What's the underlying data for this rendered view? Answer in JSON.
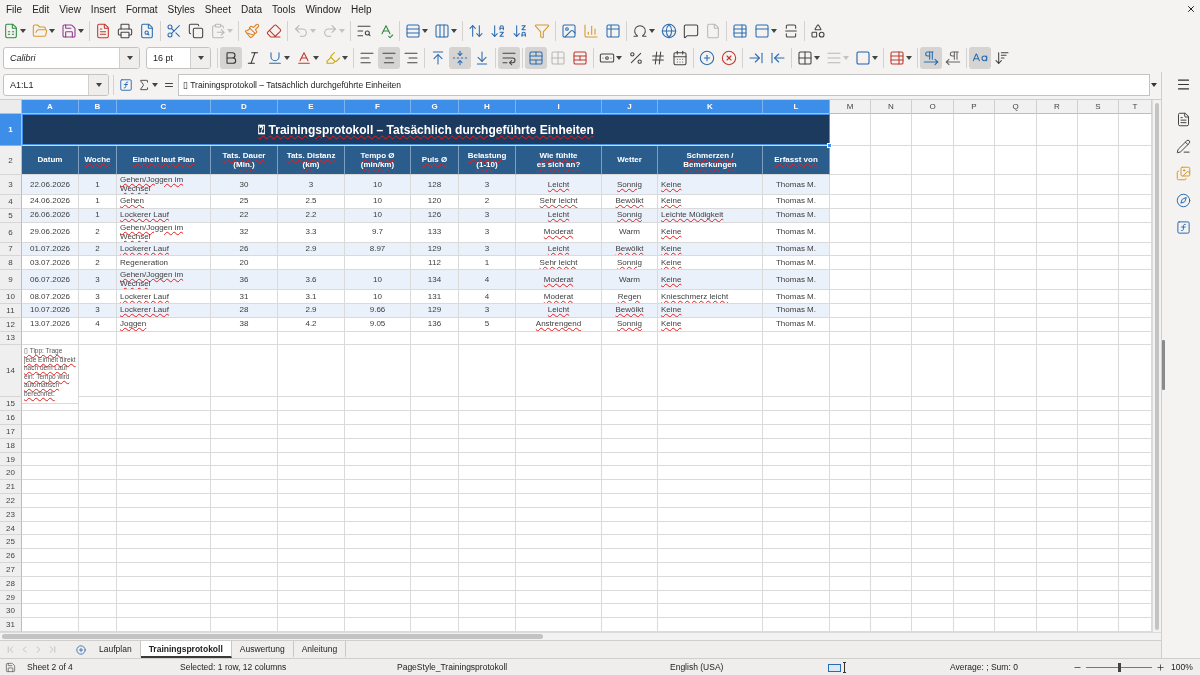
{
  "menu_bar": {
    "items": [
      "File",
      "Edit",
      "View",
      "Insert",
      "Format",
      "Styles",
      "Sheet",
      "Data",
      "Tools",
      "Window",
      "Help"
    ]
  },
  "standard_toolbar": {
    "buttons": [
      {
        "disabled": false
      },
      {
        "disabled": false
      },
      {
        "disabled": false
      },
      {
        "disabled": false
      },
      {
        "disabled": false
      },
      {
        "disabled": false
      },
      {
        "disabled": false
      },
      {
        "disabled": false
      },
      {
        "disabled": true
      },
      {
        "disabled": false
      },
      {
        "disabled": false
      },
      {
        "disabled": true
      },
      {
        "disabled": true
      },
      {
        "disabled": false
      },
      {
        "disabled": false
      },
      {
        "disabled": false
      },
      {
        "disabled": false
      },
      {
        "disabled": false
      },
      {
        "disabled": false
      },
      {
        "disabled": false
      },
      {
        "disabled": false
      },
      {
        "disabled": false
      },
      {
        "disabled": false
      },
      {
        "disabled": false
      },
      {
        "disabled": false
      },
      {
        "disabled": false
      },
      {
        "disabled": false
      },
      {
        "disabled": true
      },
      {
        "disabled": false
      },
      {
        "disabled": false
      },
      {
        "disabled": false
      },
      {
        "disabled": false
      }
    ]
  },
  "formatting_toolbar": {
    "font_name": "Calibri",
    "font_size": "16 pt",
    "buttons": [
      {
        "pressed": true,
        "disabled": false
      },
      {
        "pressed": false,
        "disabled": false
      },
      {
        "pressed": false,
        "disabled": false
      },
      {
        "pressed": false,
        "disabled": false
      },
      {
        "pressed": false,
        "disabled": false
      },
      {
        "pressed": false,
        "disabled": false
      },
      {
        "pressed": true,
        "disabled": false
      },
      {
        "pressed": false,
        "disabled": false
      },
      {
        "pressed": false,
        "disabled": false
      },
      {
        "pressed": true,
        "disabled": false
      },
      {
        "pressed": false,
        "disabled": false
      },
      {
        "pressed": true,
        "disabled": false
      },
      {
        "pressed": true,
        "disabled": false
      },
      {
        "pressed": false,
        "disabled": true
      },
      {
        "pressed": false,
        "disabled": false
      },
      {
        "pressed": false,
        "disabled": false
      },
      {
        "pressed": false,
        "disabled": false
      },
      {
        "pressed": false,
        "disabled": false
      },
      {
        "pressed": false,
        "disabled": false
      },
      {
        "pressed": false,
        "disabled": false
      },
      {
        "pressed": false,
        "disabled": false
      },
      {
        "pressed": false,
        "disabled": false
      },
      {
        "pressed": false,
        "disabled": false
      },
      {
        "pressed": false,
        "disabled": false
      },
      {
        "pressed": false,
        "disabled": true
      },
      {
        "pressed": false,
        "disabled": false
      },
      {
        "pressed": false,
        "disabled": false
      },
      {
        "pressed": true,
        "disabled": false
      },
      {
        "pressed": false,
        "disabled": false
      },
      {
        "pressed": true,
        "disabled": false
      },
      {
        "pressed": false,
        "disabled": false
      }
    ]
  },
  "formula_bar": {
    "name_box": "A1:L1",
    "content": "▯ Trainingsprotokoll – Tatsächlich durchgeführte Einheiten"
  },
  "sheet": {
    "columns": [
      {
        "letter": "A",
        "selected": true
      },
      {
        "letter": "B",
        "selected": true
      },
      {
        "letter": "C",
        "selected": true
      },
      {
        "letter": "D",
        "selected": true
      },
      {
        "letter": "E",
        "selected": true
      },
      {
        "letter": "F",
        "selected": true
      },
      {
        "letter": "G",
        "selected": true
      },
      {
        "letter": "H",
        "selected": true
      },
      {
        "letter": "I",
        "selected": true
      },
      {
        "letter": "J",
        "selected": true
      },
      {
        "letter": "K",
        "selected": true
      },
      {
        "letter": "L",
        "selected": true
      },
      {
        "letter": "M",
        "selected": false
      },
      {
        "letter": "N",
        "selected": false
      },
      {
        "letter": "O",
        "selected": false
      },
      {
        "letter": "P",
        "selected": false
      },
      {
        "letter": "Q",
        "selected": false
      },
      {
        "letter": "R",
        "selected": false
      },
      {
        "letter": "S",
        "selected": false
      },
      {
        "letter": "T",
        "selected": false
      }
    ],
    "row_headers": [
      {
        "label": "1",
        "selected": true
      },
      {
        "label": "2",
        "selected": false
      },
      {
        "label": "3",
        "selected": false
      },
      {
        "label": "4",
        "selected": false
      },
      {
        "label": "5",
        "selected": false
      },
      {
        "label": "6",
        "selected": false
      },
      {
        "label": "7",
        "selected": false
      },
      {
        "label": "8",
        "selected": false
      },
      {
        "label": "9",
        "selected": false
      },
      {
        "label": "10",
        "selected": false
      },
      {
        "label": "11",
        "selected": false
      },
      {
        "label": "12",
        "selected": false
      },
      {
        "label": "13",
        "selected": false
      },
      {
        "label": "14",
        "selected": false
      },
      {
        "label": "15",
        "selected": false
      },
      {
        "label": "16",
        "selected": false
      },
      {
        "label": "17",
        "selected": false
      },
      {
        "label": "18",
        "selected": false
      },
      {
        "label": "19",
        "selected": false
      },
      {
        "label": "20",
        "selected": false
      },
      {
        "label": "21",
        "selected": false
      },
      {
        "label": "22",
        "selected": false
      },
      {
        "label": "23",
        "selected": false
      },
      {
        "label": "24",
        "selected": false
      },
      {
        "label": "25",
        "selected": false
      },
      {
        "label": "26",
        "selected": false
      },
      {
        "label": "27",
        "selected": false
      },
      {
        "label": "28",
        "selected": false
      },
      {
        "label": "29",
        "selected": false
      },
      {
        "label": "30",
        "selected": false
      },
      {
        "label": "31",
        "selected": false
      }
    ],
    "title": {
      "text": "⍰ Trainingsprotokoll – Tatsächlich durchgeführte Einheiten",
      "spell_marked": true,
      "selected": true
    },
    "header": [
      {
        "text": "Datum",
        "spell_marked": false
      },
      {
        "text": "Woche",
        "spell_marked": true
      },
      {
        "text": "Einheit laut Plan",
        "spell_marked": true
      },
      {
        "text": "Tats. Dauer\n(Min.)",
        "spell_marked": true
      },
      {
        "text": "Tats. Distanz\n(km)",
        "spell_marked": true
      },
      {
        "text": "Tempo Ø\n(min/km)",
        "spell_marked": true
      },
      {
        "text": "Puls Ø",
        "spell_marked": true
      },
      {
        "text": "Belastung\n(1-10)",
        "spell_marked": true
      },
      {
        "text": "Wie fühlte\nes sich an?",
        "spell_marked": true
      },
      {
        "text": "Wetter",
        "spell_marked": false
      },
      {
        "text": "Schmerzen /\nBemerkungen",
        "spell_marked": true
      },
      {
        "text": "Erfasst von",
        "spell_marked": true
      }
    ],
    "rows": [
      {
        "date": "22.06.2026",
        "week": "1",
        "session": "Gehen/Joggen im Wechsel",
        "duration": "30",
        "distance": "3",
        "pace": "10",
        "pulse": "128",
        "load": "3",
        "feeling": "Leicht",
        "weather": "Sonnig",
        "remarks": "Keine",
        "recorded_by": "Thomas M.",
        "session_marked": true,
        "feeling_marked": true,
        "weather_marked": true,
        "remarks_marked": true
      },
      {
        "date": "24.06.2026",
        "week": "1",
        "session": "Gehen",
        "duration": "25",
        "distance": "2.5",
        "pace": "10",
        "pulse": "120",
        "load": "2",
        "feeling": "Sehr leicht",
        "weather": "Bewölkt",
        "remarks": "Keine",
        "recorded_by": "Thomas M.",
        "session_marked": true,
        "feeling_marked": true,
        "weather_marked": true,
        "remarks_marked": true
      },
      {
        "date": "26.06.2026",
        "week": "1",
        "session": "Lockerer Lauf",
        "duration": "22",
        "distance": "2.2",
        "pace": "10",
        "pulse": "126",
        "load": "3",
        "feeling": "Leicht",
        "weather": "Sonnig",
        "remarks": "Leichte Müdigkeit",
        "recorded_by": "Thomas M.",
        "session_marked": true,
        "feeling_marked": true,
        "weather_marked": true,
        "remarks_marked": true
      },
      {
        "date": "29.06.2026",
        "week": "2",
        "session": "Gehen/Joggen im Wechsel",
        "duration": "32",
        "distance": "3.3",
        "pace": "9.7",
        "pulse": "133",
        "load": "3",
        "feeling": "Moderat",
        "weather": "Warm",
        "remarks": "Keine",
        "recorded_by": "Thomas M.",
        "session_marked": true,
        "feeling_marked": true,
        "weather_marked": false,
        "remarks_marked": true
      },
      {
        "date": "01.07.2026",
        "week": "2",
        "session": "Lockerer Lauf",
        "duration": "26",
        "distance": "2.9",
        "pace": "8.97",
        "pulse": "129",
        "load": "3",
        "feeling": "Leicht",
        "weather": "Bewölkt",
        "remarks": "Keine",
        "recorded_by": "Thomas M.",
        "session_marked": true,
        "feeling_marked": true,
        "weather_marked": true,
        "remarks_marked": true
      },
      {
        "date": "03.07.2026",
        "week": "2",
        "session": "Regeneration",
        "duration": "20",
        "pulse": "112",
        "load": "1",
        "feeling": "Sehr leicht",
        "weather": "Sonnig",
        "remarks": "Keine",
        "recorded_by": "Thomas M.",
        "session_marked": false,
        "feeling_marked": true,
        "weather_marked": true,
        "remarks_marked": true
      },
      {
        "date": "06.07.2026",
        "week": "3",
        "session": "Gehen/Joggen im Wechsel",
        "duration": "36",
        "distance": "3.6",
        "pace": "10",
        "pulse": "134",
        "load": "4",
        "feeling": "Moderat",
        "weather": "Warm",
        "remarks": "Keine",
        "recorded_by": "Thomas M.",
        "session_marked": true,
        "feeling_marked": true,
        "weather_marked": false,
        "remarks_marked": true
      },
      {
        "date": "08.07.2026",
        "week": "3",
        "session": "Lockerer Lauf",
        "duration": "31",
        "distance": "3.1",
        "pace": "10",
        "pulse": "131",
        "load": "4",
        "feeling": "Moderat",
        "weather": "Regen",
        "remarks": "Knieschmerz leicht",
        "recorded_by": "Thomas M.",
        "session_marked": true,
        "feeling_marked": true,
        "weather_marked": true,
        "remarks_marked": true
      },
      {
        "date": "10.07.2026",
        "week": "3",
        "session": "Lockerer Lauf",
        "duration": "28",
        "distance": "2.9",
        "pace": "9.66",
        "pulse": "129",
        "load": "3",
        "feeling": "Leicht",
        "weather": "Bewölkt",
        "remarks": "Keine",
        "recorded_by": "Thomas M.",
        "session_marked": true,
        "feeling_marked": true,
        "weather_marked": true,
        "remarks_marked": true
      },
      {
        "date": "13.07.2026",
        "week": "4",
        "session": "Joggen",
        "duration": "38",
        "distance": "4.2",
        "pace": "9.05",
        "pulse": "136",
        "load": "5",
        "feeling": "Anstrengend",
        "weather": "Sonnig",
        "remarks": "Keine",
        "recorded_by": "Thomas M.",
        "session_marked": true,
        "feeling_marked": true,
        "weather_marked": true,
        "remarks_marked": true
      }
    ],
    "note": {
      "text": "▯ Tipp: Trage jede Einheit direkt nach dem Lauf ein. Tempo wird automatisch berechnet.",
      "spell_marked": true
    }
  },
  "sheet_tabs": {
    "navigation": [
      {
        "disabled": true
      },
      {
        "disabled": true
      },
      {
        "disabled": true
      },
      {
        "disabled": true
      }
    ],
    "tabs": [
      {
        "label": "Laufplan",
        "selected": false
      },
      {
        "label": "Trainingsprotokoll",
        "selected": true
      },
      {
        "label": "Auswertung",
        "selected": false
      },
      {
        "label": "Anleitung",
        "selected": false
      }
    ]
  },
  "status_bar": {
    "sheet": "Sheet 2 of 4",
    "selection": "Selected: 1 row, 12 columns",
    "page_style": "PageStyle_Trainingsprotokoll",
    "language": "English (USA)",
    "summary": "Average: ; Sum: 0",
    "zoom": {
      "level": 0.5,
      "reading": "100%"
    }
  }
}
